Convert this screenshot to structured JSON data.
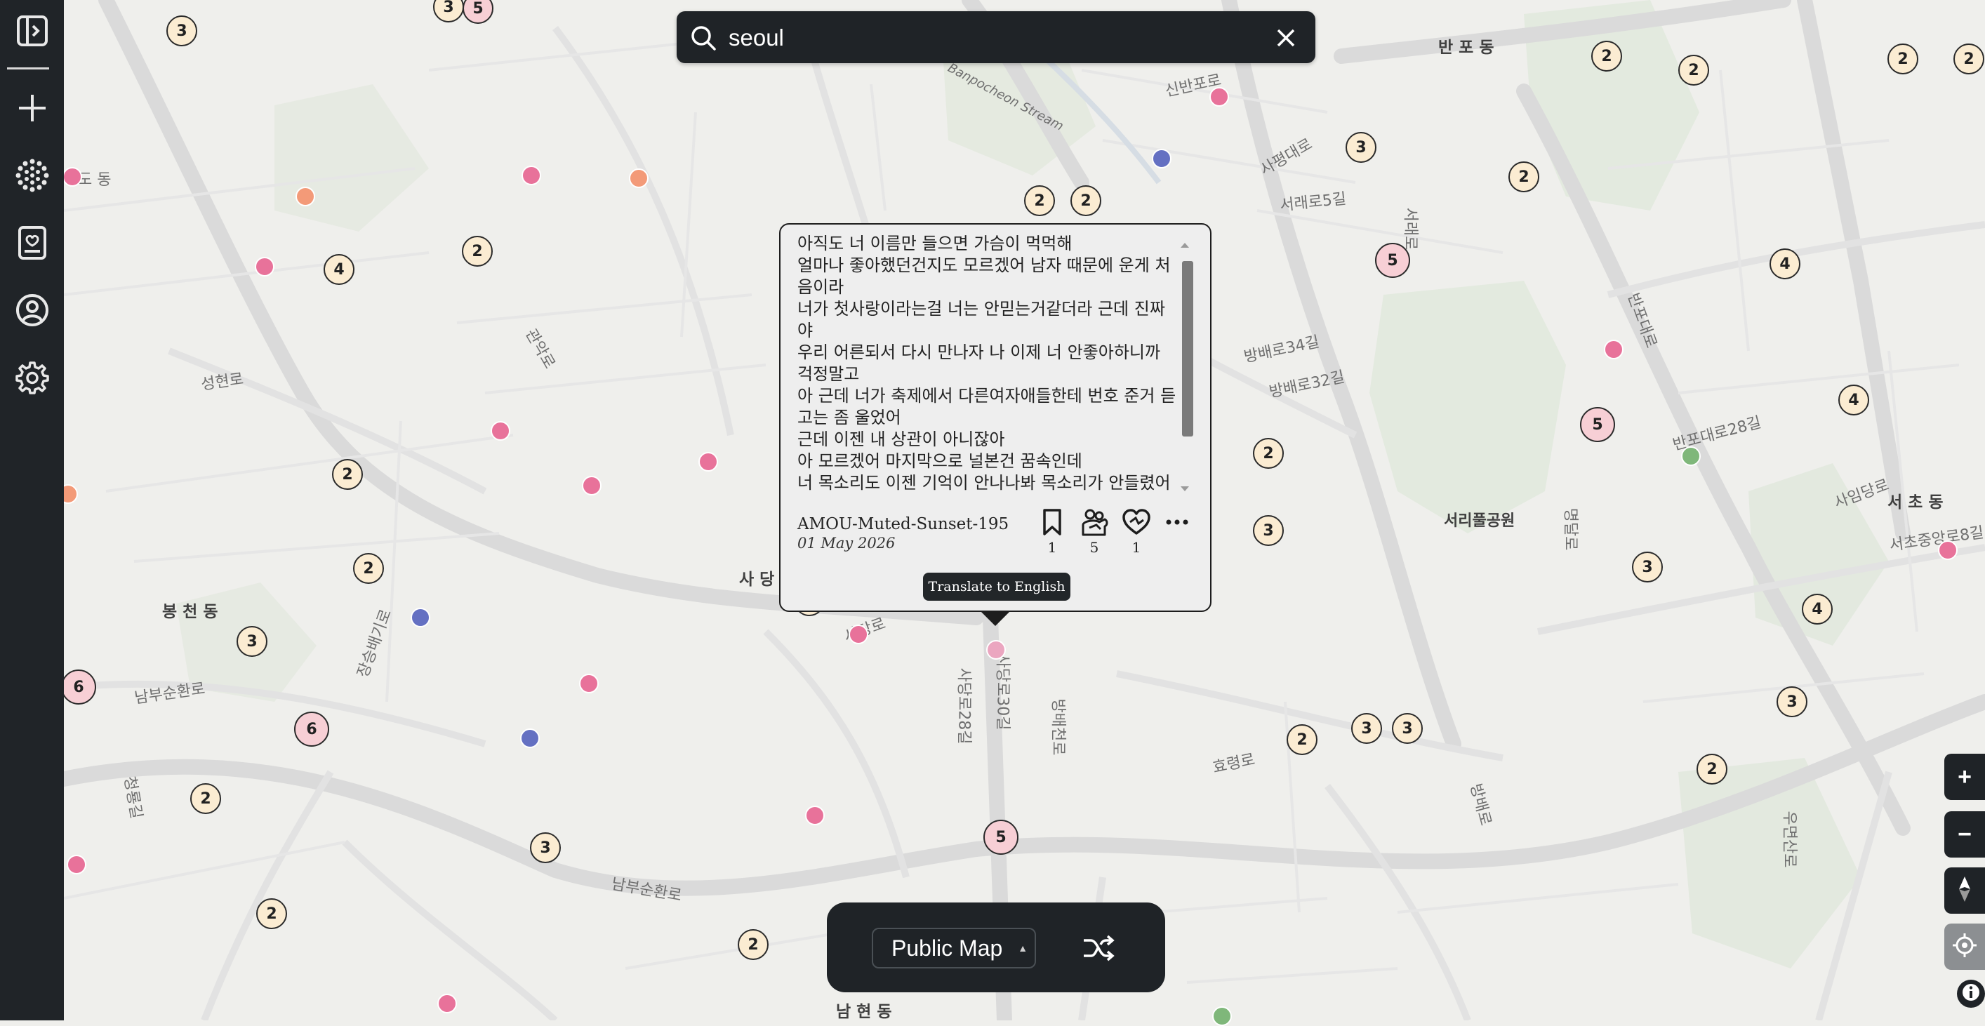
{
  "search": {
    "query": "seoul"
  },
  "map_labels": {
    "banpo": "반 포 동",
    "sinbanpo": "신반포로",
    "pocheon": "Banpocheon Stream",
    "sapyeong": "사평대로",
    "seorae5": "서래로5길",
    "seorae": "서래로",
    "bangbae34": "방배로34길",
    "bangbae32": "방배로32길",
    "seongheon": "성현로",
    "sadangdong": "사 당 동",
    "bongcheon": "봉 천 동",
    "nambusunhwan": "남부순환로",
    "nambusunhwan2": "남부순환로",
    "sadangro": "사당로",
    "sadang28": "사당로28길",
    "sadang30": "사당로30길",
    "bangbaecheon": "방배천로",
    "hyoryeong": "효령로",
    "bangbaero": "방배로",
    "seoripul": "서리풀공원",
    "myeongdalro": "명달로",
    "banpodaero": "반포대로",
    "banpodaero28": "반포대로28길",
    "seochodong": "서 초 동",
    "sapyeongro": "사임당로",
    "seochojungang": "서초중앙로8길",
    "umyeonsan": "우면산로",
    "namhyeon": "남 현 동",
    "cheongnyong": "청룡길",
    "dodong": "도 동",
    "jangsoon": "장승배기로",
    "gwanak": "관악로"
  },
  "clusters": [
    {
      "label": "3"
    },
    {
      "label": "5"
    },
    {
      "label": "3"
    },
    {
      "label": "2"
    },
    {
      "label": "4"
    },
    {
      "label": "2"
    },
    {
      "label": "2"
    },
    {
      "label": "2"
    },
    {
      "label": "3"
    },
    {
      "label": "6"
    },
    {
      "label": "6"
    },
    {
      "label": "2"
    },
    {
      "label": "3"
    },
    {
      "label": "2"
    },
    {
      "label": "2"
    },
    {
      "label": "2"
    },
    {
      "label": "3"
    },
    {
      "label": "5"
    },
    {
      "label": "2"
    },
    {
      "label": "3"
    },
    {
      "label": "2"
    },
    {
      "label": "3"
    },
    {
      "label": "2"
    },
    {
      "label": "2"
    },
    {
      "label": "3"
    },
    {
      "label": "5"
    },
    {
      "label": "2"
    },
    {
      "label": "2"
    },
    {
      "label": "2"
    },
    {
      "label": "2"
    },
    {
      "label": "4"
    },
    {
      "label": "5"
    },
    {
      "label": "4"
    },
    {
      "label": "3"
    },
    {
      "label": "4"
    },
    {
      "label": "3"
    },
    {
      "label": "2"
    },
    {
      "label": "5"
    }
  ],
  "popup": {
    "text": "아직도 너 이름만 들으면 가슴이 먹먹해\n얼마나 좋아했던건지도 모르겠어 남자 때문에 운게 처음이라\n너가 첫사랑이라는걸 너는 안믿는거같더라 근데 진짜야\n우리 어른되서 다시 만나자 나 이제 너 안좋아하니까 걱정말고\n아 근데 너가 축제에서 다른여자애들한테 번호 준거 듣고는 좀 울었어\n근데 이젠 내 상관이 아니잖아\n아 모르겠어 마지막으로 널본건 꿈속인데\n너 목소리도 이젠 기억이 안나나봐 목소리가 안들렸어",
    "author": "AMOU-Muted-Sunset-195",
    "date": "01 May 2026",
    "bookmark_count": "1",
    "hug_count": "5",
    "heart_count": "1",
    "translate_label": "Translate to English"
  },
  "bottom_bar": {
    "map_select_label": "Public Map"
  },
  "controls": {
    "zoom_in": "+",
    "zoom_out": "−"
  },
  "colors": {
    "sidebar_bg": "#202428",
    "cluster_fill": "#fbecd2",
    "cluster_big_fill": "#f7cfd5",
    "pin_pink": "#e8729a",
    "pin_orange": "#f39a78",
    "pin_blue": "#6470c2",
    "pin_green": "#7fb77a"
  }
}
